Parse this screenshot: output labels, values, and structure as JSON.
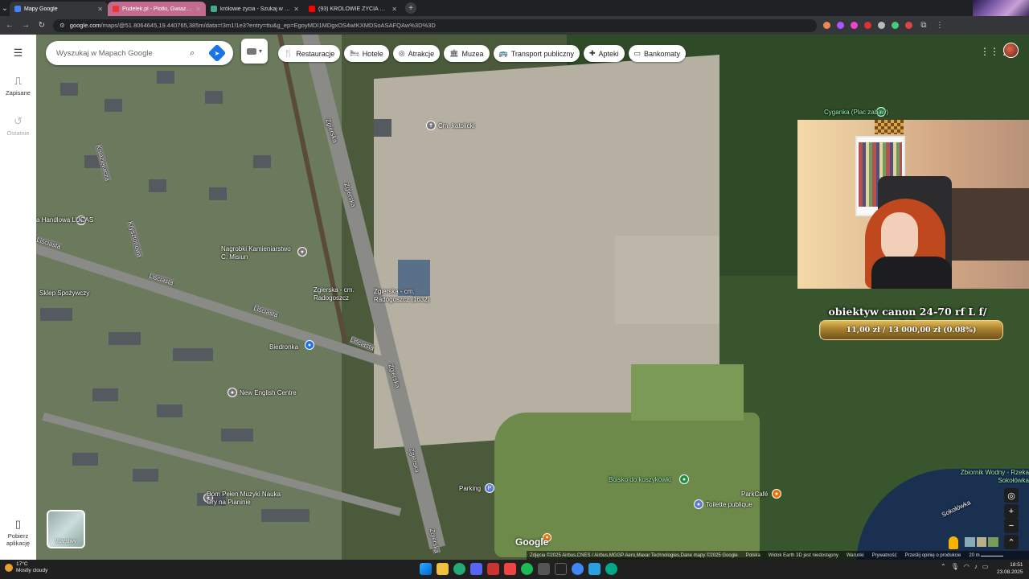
{
  "browser": {
    "tabs": [
      {
        "title": "Mapy Google",
        "color": "#4285f4",
        "active": true
      },
      {
        "title": "Pudelek.pl - Plotki, Gwiazdy, S",
        "color": "#e33",
        "active": false,
        "pink": true
      },
      {
        "title": "królowie życia - Szukaj w Googl",
        "color": "#4a8",
        "active": false
      },
      {
        "title": "(93) KRÓLOWIE ŻYCIA Sezon 6",
        "color": "#f00",
        "active": false
      }
    ],
    "url_host": "google.com",
    "url_path": "/maps/@51.8064645,19.440765,385m/data=!3m1!1e3?entry=ttu&g_ep=EgoyMDI1MDgxOS4wIKXMDSoASAFQAw%3D%3D"
  },
  "sidebar": {
    "saved_label": "Zapisane",
    "recent_label": "Ostatnie",
    "download_label": "Pobierz aplikację"
  },
  "search": {
    "placeholder": "Wyszukaj w Mapach Google"
  },
  "chips": [
    {
      "label": "Restauracje",
      "icon": "fork-knife-icon",
      "glyph": "🍴"
    },
    {
      "label": "Hotele",
      "icon": "bed-icon",
      "glyph": "🛏"
    },
    {
      "label": "Atrakcje",
      "icon": "camera-icon",
      "glyph": "◎"
    },
    {
      "label": "Muzea",
      "icon": "museum-icon",
      "glyph": "🏛"
    },
    {
      "label": "Transport publiczny",
      "icon": "bus-icon",
      "glyph": "🚌"
    },
    {
      "label": "Apteki",
      "icon": "pharmacy-icon",
      "glyph": "✚"
    },
    {
      "label": "Bankomaty",
      "icon": "atm-icon",
      "glyph": "▭"
    }
  ],
  "map_labels": {
    "cyganka": "Cyganka (Plac zabaw)",
    "cm_katolicki": "Cm. katolicki",
    "zgierska_1": "Zgierska",
    "zgierska_2": "Zgierska",
    "zgierska_3": "Zgierska",
    "zgierska_4": "Zgierska",
    "zgierska_5": "Zgierska",
    "kniaziewicza": "Kniaziewicza",
    "krysztonowa": "Krysztonowa",
    "lisciasta_1": "Liściasta",
    "lisciasta_2": "Liściasta",
    "lisciasta_3": "Liściasta",
    "lisciasta_4": "Liściasta",
    "handlowa": "a Handlowa LUCAS",
    "sklep": "Sklep Spożywczy",
    "nagrobki": "Nagrobki Kamieniarstwo C. Misiun",
    "cmentarz": "Zgierska - cm. Radogoszcz (1632)",
    "cmentarz2": "Zgierska - cm. Radogoszcz",
    "biedronka": "Biedronka",
    "new_english": "New English Centre",
    "dom_muzyki": "Dom Pełen Muzyki Nauka Gry na Pianinie",
    "parking": "Parking",
    "boisko": "Boisko do koszykówki",
    "toilette": "Toilette publique",
    "parkcafe": "ParkCafé",
    "zbiornik": "Zbiornik Wodny - Rzeka Sokołówka",
    "sokolowka": "Sokołówka",
    "layers": "Warstwy",
    "google": "Google"
  },
  "goal": {
    "title": "obiektyw canon 24-70 rf L f/ 2.0",
    "progress_text": "11,00 zł / 13 000,00 zł  (0.08%)",
    "progress_fraction": 0.0008
  },
  "attribution": {
    "imagery": "Zdjęcia ©2025 Airbus,CNES / Airbus,MGGP Aero,Maxar Technologies,Dane mapy ©2025 Google",
    "country": "Polska",
    "earth3d": "Widok Earth 3D jest niedostępny",
    "terms": "Warunki",
    "privacy": "Prywatność",
    "feedback": "Prześlij opinię o produkcie",
    "scale": "20 m"
  },
  "taskbar": {
    "temp": "17°C",
    "weather": "Mostly cloudy",
    "time": "18:51",
    "date": "23.08.2025"
  },
  "colors": {
    "accent": "#1a73e8",
    "goal_gold": "#c9a040"
  }
}
